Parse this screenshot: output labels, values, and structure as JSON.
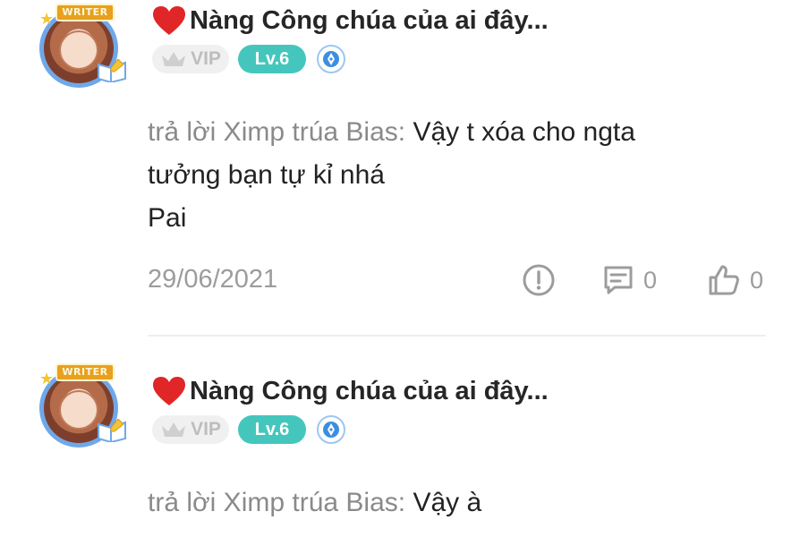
{
  "comments": [
    {
      "avatar_badge": "WRITER",
      "username": "Nàng Công chúa của ai đây...",
      "vip_label": "VIP",
      "level": "Lv.6",
      "reply_prefix": "trả lời Ximp trúa Bias:",
      "content_lines": [
        "Vậy t xóa cho ngta",
        "tưởng bạn tự kỉ nhá",
        "Pai"
      ],
      "date": "29/06/2021",
      "comment_count": "0",
      "like_count": "0"
    },
    {
      "avatar_badge": "WRITER",
      "username": "Nàng Công chúa của ai đây...",
      "vip_label": "VIP",
      "level": "Lv.6",
      "reply_prefix": "trả lời Ximp trúa Bias:",
      "content_lines": [
        "Vậy à"
      ]
    }
  ],
  "colors": {
    "level_badge": "#45c6bd",
    "heart": "#e02626",
    "meta_text": "#9c9c9c",
    "reply_prefix": "#8a8a8a",
    "avatar_ring": "#6fa8ea"
  },
  "icons": {
    "heart": "heart-icon",
    "vip": "crown-icon",
    "author_badge": "pen-nib-icon",
    "report": "exclamation-circle-icon",
    "comment": "comment-icon",
    "like": "thumbs-up-icon"
  }
}
